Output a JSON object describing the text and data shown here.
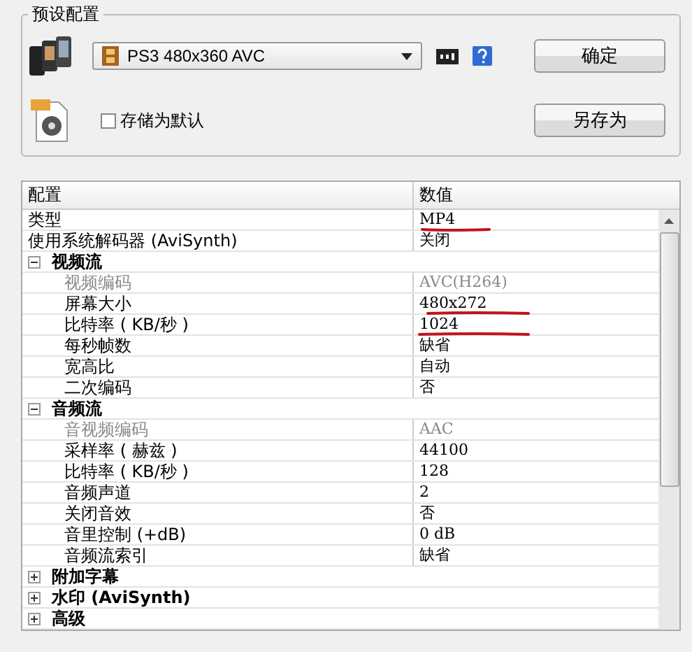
{
  "preset_group": {
    "title": "预设配置",
    "preset_dropdown": {
      "value": "PS3 480x360 AVC"
    },
    "ok_button": "确定",
    "save_default": {
      "label": "存储为默认",
      "checked": false
    },
    "save_as_button": "另存为"
  },
  "table": {
    "columns": [
      "配置",
      "数值"
    ],
    "rows": [
      {
        "kind": "property",
        "name": "类型",
        "value": "MP4",
        "disabled": false
      },
      {
        "kind": "property",
        "name": "使用系统解码器 (AviSynth)",
        "value": "关闭",
        "disabled": false
      },
      {
        "kind": "category",
        "name": "视频流",
        "expanded": true,
        "children": [
          {
            "kind": "property",
            "name": "视频编码",
            "value": "AVC(H264)",
            "disabled": true
          },
          {
            "kind": "property",
            "name": "屏幕大小",
            "value": "480x272",
            "disabled": false
          },
          {
            "kind": "property",
            "name": "比特率 ( KB/秒 )",
            "value": "1024",
            "disabled": false
          },
          {
            "kind": "property",
            "name": "每秒帧数",
            "value": "缺省",
            "disabled": false
          },
          {
            "kind": "property",
            "name": "宽高比",
            "value": "自动",
            "disabled": false
          },
          {
            "kind": "property",
            "name": "二次编码",
            "value": "否",
            "disabled": false
          }
        ]
      },
      {
        "kind": "category",
        "name": "音频流",
        "expanded": true,
        "children": [
          {
            "kind": "property",
            "name": "音视频编码",
            "value": "AAC",
            "disabled": true
          },
          {
            "kind": "property",
            "name": "采样率 ( 赫兹 )",
            "value": "44100",
            "disabled": false
          },
          {
            "kind": "property",
            "name": "比特率 ( KB/秒 )",
            "value": "128",
            "disabled": false
          },
          {
            "kind": "property",
            "name": "音频声道",
            "value": "2",
            "disabled": false
          },
          {
            "kind": "property",
            "name": "关闭音效",
            "value": "否",
            "disabled": false
          },
          {
            "kind": "property",
            "name": "音里控制 (+dB)",
            "value": "0 dB",
            "disabled": false
          },
          {
            "kind": "property",
            "name": "音频流索引",
            "value": "缺省",
            "disabled": false
          }
        ]
      },
      {
        "kind": "category",
        "name": "附加字幕",
        "expanded": false
      },
      {
        "kind": "category",
        "name": "水印 (AviSynth)",
        "expanded": false
      },
      {
        "kind": "category",
        "name": "高级",
        "expanded": false
      }
    ]
  }
}
